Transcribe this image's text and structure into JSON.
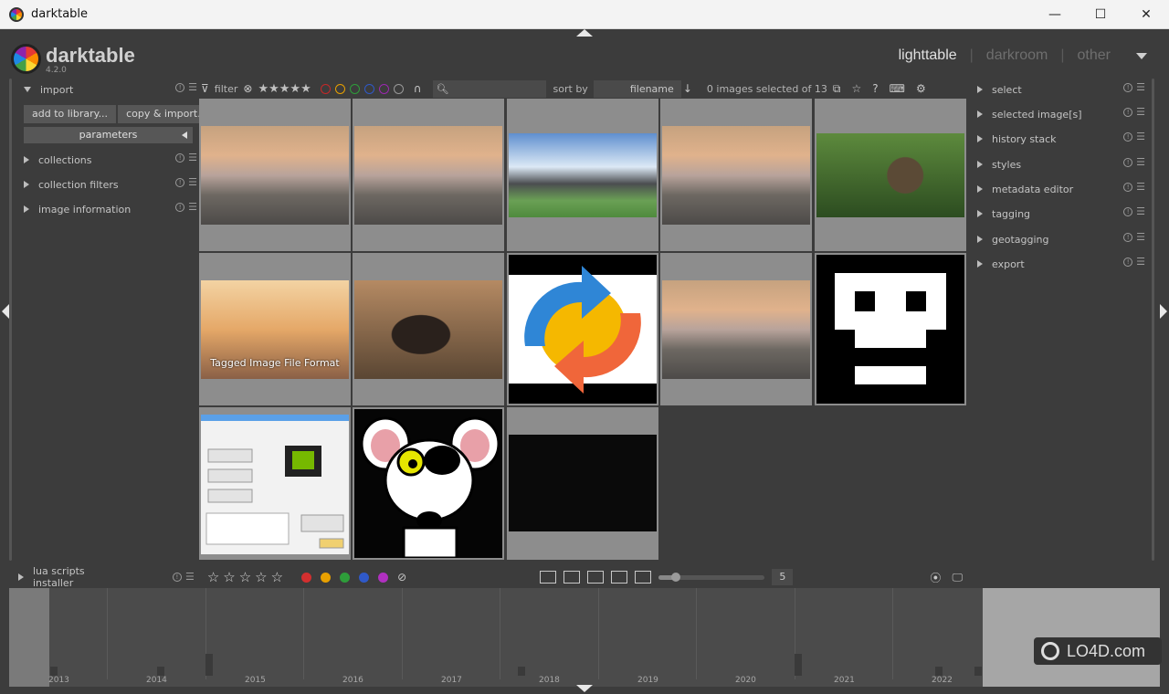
{
  "window": {
    "title": "darktable",
    "minimize": "—",
    "maximize": "☐",
    "close": "✕"
  },
  "header": {
    "app_name": "darktable",
    "version": "4.2.0",
    "views": [
      "lighttable",
      "darkroom",
      "other"
    ],
    "active_view": "lighttable"
  },
  "left_panel": {
    "import_label": "import",
    "add_to_library": "add to library...",
    "copy_import": "copy & import...",
    "parameters": "parameters",
    "modules": [
      "collections",
      "collection filters",
      "image information"
    ],
    "lua": "lua scripts installer"
  },
  "right_panel": {
    "modules": [
      "select",
      "selected image[s]",
      "history stack",
      "styles",
      "metadata editor",
      "tagging",
      "geotagging",
      "export"
    ]
  },
  "filterbar": {
    "filter_label": "filter",
    "stars": "★★★★★",
    "color_labels": [
      "#c62828",
      "#e8a000",
      "#2e9d3a",
      "#2f59c8",
      "#9c27b0"
    ],
    "sort_label": "sort by",
    "sort_value": "filename",
    "selection_status": "0 images selected of 13"
  },
  "grid": {
    "caption_laptop": "Tagged Image File Format"
  },
  "bottombar": {
    "stars": "☆☆☆☆☆",
    "color_dots": [
      "#d32f2f",
      "#e8a000",
      "#2e9d3a",
      "#2f59c8",
      "#b030c0"
    ],
    "zoom_value": "5"
  },
  "timeline": {
    "years": [
      "2013",
      "2014",
      "2015",
      "2016",
      "2017",
      "2018",
      "2019",
      "2020",
      "2021",
      "2022"
    ]
  },
  "watermark": "LO4D.com"
}
